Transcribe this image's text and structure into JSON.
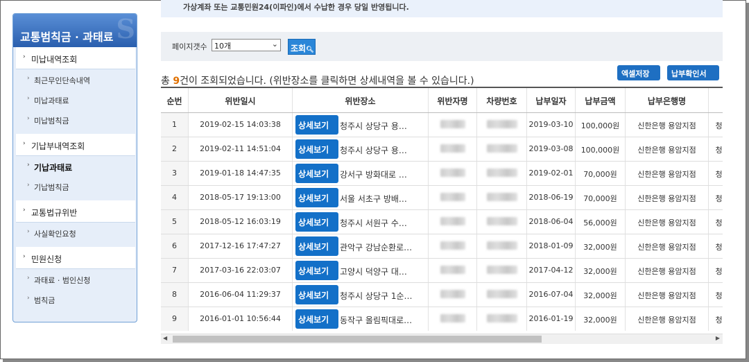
{
  "notice": "가상계좌 또는 교통민원24(이파인)에서 수납한 경우 당일 반영됩니다.",
  "sidebar": {
    "title": "교통범칙금 · 과태료",
    "deco": "S",
    "items": [
      {
        "type": "top",
        "label": "미납내역조회"
      },
      {
        "type": "sub",
        "label": "최근무인단속내역"
      },
      {
        "type": "sub",
        "label": "미납과태료"
      },
      {
        "type": "sub",
        "label": "미납범칙금"
      },
      {
        "type": "top",
        "label": "기납부내역조회"
      },
      {
        "type": "sub",
        "label": "기납과태료",
        "active": true
      },
      {
        "type": "sub",
        "label": "기납범칙금"
      },
      {
        "type": "top",
        "label": "교통법규위반"
      },
      {
        "type": "sub",
        "label": "사실확인요청"
      },
      {
        "type": "top",
        "label": "민원신청"
      },
      {
        "type": "sub",
        "label": "과태료 · 범인신청"
      },
      {
        "type": "sub",
        "label": "범칙금"
      }
    ]
  },
  "search": {
    "page_count_label": "페이지갯수",
    "page_count_value": "10개",
    "search_button": "조회"
  },
  "summary": {
    "prefix": "총 ",
    "count": "9",
    "suffix": "건이 조회되었습니다. (위반장소를 클릭하면 상세내역을 볼 수 있습니다.)"
  },
  "buttons": {
    "excel": "엑셀저장",
    "receipt": "납부확인서"
  },
  "table": {
    "headers": [
      "순번",
      "위반일시",
      "위반장소",
      "위반자명",
      "차량번호",
      "납부일자",
      "납부금액",
      "납부은행명",
      ""
    ],
    "detail_label": "상세보기",
    "rows": [
      {
        "no": "1",
        "datetime": "2019-02-15 14:03:38",
        "place": "청주시 상당구 용…",
        "paid_date": "2019-03-10",
        "amount": "100,000원",
        "bank": "신한은행 용암지점",
        "extra": "청"
      },
      {
        "no": "2",
        "datetime": "2019-02-11 14:51:04",
        "place": "청주시 상당구 용…",
        "paid_date": "2019-03-08",
        "amount": "100,000원",
        "bank": "신한은행 용암지점",
        "extra": "청"
      },
      {
        "no": "3",
        "datetime": "2019-01-18 14:47:35",
        "place": "강서구 방화대로 …",
        "paid_date": "2019-02-01",
        "amount": "70,000원",
        "bank": "신한은행 용암지점",
        "extra": "청"
      },
      {
        "no": "4",
        "datetime": "2018-05-17 19:13:00",
        "place": "서울 서초구 방배…",
        "paid_date": "2018-06-19",
        "amount": "70,000원",
        "bank": "신한은행 용암지점",
        "extra": "청"
      },
      {
        "no": "5",
        "datetime": "2018-05-12 16:03:19",
        "place": "청주시 서원구 수…",
        "paid_date": "2018-06-04",
        "amount": "56,000원",
        "bank": "신한은행 용암지점",
        "extra": "청"
      },
      {
        "no": "6",
        "datetime": "2017-12-16 17:47:27",
        "place": "관악구 강남순환로…",
        "paid_date": "2018-01-09",
        "amount": "32,000원",
        "bank": "신한은행 용암지점",
        "extra": "청"
      },
      {
        "no": "7",
        "datetime": "2017-03-16 22:03:07",
        "place": "고양시 덕양구 대…",
        "paid_date": "2017-04-12",
        "amount": "32,000원",
        "bank": "신한은행 용암지점",
        "extra": "청"
      },
      {
        "no": "8",
        "datetime": "2016-06-04 11:29:37",
        "place": "청주시 상당구 1순…",
        "paid_date": "2016-07-04",
        "amount": "32,000원",
        "bank": "신한은행 용암지점",
        "extra": "청"
      },
      {
        "no": "9",
        "datetime": "2016-01-01 10:56:44",
        "place": "동작구 올림픽대로…",
        "paid_date": "2016-01-19",
        "amount": "32,000원",
        "bank": "신한은행 용암지점",
        "extra": "청"
      }
    ]
  },
  "icons": {
    "search_button_icon": "search-icon",
    "select_chevron": "chevron-down-icon",
    "menu_arrow": "chevron-right-icon"
  }
}
